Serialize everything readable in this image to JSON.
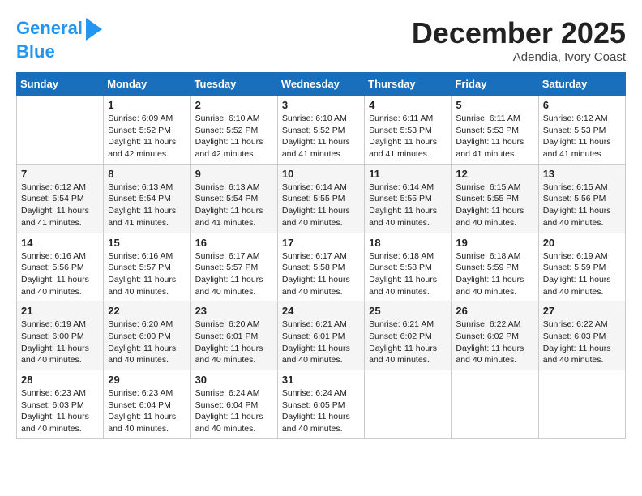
{
  "header": {
    "logo_line1": "General",
    "logo_line2": "Blue",
    "month": "December 2025",
    "location": "Adendia, Ivory Coast"
  },
  "days_of_week": [
    "Sunday",
    "Monday",
    "Tuesday",
    "Wednesday",
    "Thursday",
    "Friday",
    "Saturday"
  ],
  "weeks": [
    [
      {
        "day": "",
        "sunrise": "",
        "sunset": "",
        "daylight": ""
      },
      {
        "day": "1",
        "sunrise": "Sunrise: 6:09 AM",
        "sunset": "Sunset: 5:52 PM",
        "daylight": "Daylight: 11 hours and 42 minutes."
      },
      {
        "day": "2",
        "sunrise": "Sunrise: 6:10 AM",
        "sunset": "Sunset: 5:52 PM",
        "daylight": "Daylight: 11 hours and 42 minutes."
      },
      {
        "day": "3",
        "sunrise": "Sunrise: 6:10 AM",
        "sunset": "Sunset: 5:52 PM",
        "daylight": "Daylight: 11 hours and 41 minutes."
      },
      {
        "day": "4",
        "sunrise": "Sunrise: 6:11 AM",
        "sunset": "Sunset: 5:53 PM",
        "daylight": "Daylight: 11 hours and 41 minutes."
      },
      {
        "day": "5",
        "sunrise": "Sunrise: 6:11 AM",
        "sunset": "Sunset: 5:53 PM",
        "daylight": "Daylight: 11 hours and 41 minutes."
      },
      {
        "day": "6",
        "sunrise": "Sunrise: 6:12 AM",
        "sunset": "Sunset: 5:53 PM",
        "daylight": "Daylight: 11 hours and 41 minutes."
      }
    ],
    [
      {
        "day": "7",
        "sunrise": "Sunrise: 6:12 AM",
        "sunset": "Sunset: 5:54 PM",
        "daylight": "Daylight: 11 hours and 41 minutes."
      },
      {
        "day": "8",
        "sunrise": "Sunrise: 6:13 AM",
        "sunset": "Sunset: 5:54 PM",
        "daylight": "Daylight: 11 hours and 41 minutes."
      },
      {
        "day": "9",
        "sunrise": "Sunrise: 6:13 AM",
        "sunset": "Sunset: 5:54 PM",
        "daylight": "Daylight: 11 hours and 41 minutes."
      },
      {
        "day": "10",
        "sunrise": "Sunrise: 6:14 AM",
        "sunset": "Sunset: 5:55 PM",
        "daylight": "Daylight: 11 hours and 40 minutes."
      },
      {
        "day": "11",
        "sunrise": "Sunrise: 6:14 AM",
        "sunset": "Sunset: 5:55 PM",
        "daylight": "Daylight: 11 hours and 40 minutes."
      },
      {
        "day": "12",
        "sunrise": "Sunrise: 6:15 AM",
        "sunset": "Sunset: 5:55 PM",
        "daylight": "Daylight: 11 hours and 40 minutes."
      },
      {
        "day": "13",
        "sunrise": "Sunrise: 6:15 AM",
        "sunset": "Sunset: 5:56 PM",
        "daylight": "Daylight: 11 hours and 40 minutes."
      }
    ],
    [
      {
        "day": "14",
        "sunrise": "Sunrise: 6:16 AM",
        "sunset": "Sunset: 5:56 PM",
        "daylight": "Daylight: 11 hours and 40 minutes."
      },
      {
        "day": "15",
        "sunrise": "Sunrise: 6:16 AM",
        "sunset": "Sunset: 5:57 PM",
        "daylight": "Daylight: 11 hours and 40 minutes."
      },
      {
        "day": "16",
        "sunrise": "Sunrise: 6:17 AM",
        "sunset": "Sunset: 5:57 PM",
        "daylight": "Daylight: 11 hours and 40 minutes."
      },
      {
        "day": "17",
        "sunrise": "Sunrise: 6:17 AM",
        "sunset": "Sunset: 5:58 PM",
        "daylight": "Daylight: 11 hours and 40 minutes."
      },
      {
        "day": "18",
        "sunrise": "Sunrise: 6:18 AM",
        "sunset": "Sunset: 5:58 PM",
        "daylight": "Daylight: 11 hours and 40 minutes."
      },
      {
        "day": "19",
        "sunrise": "Sunrise: 6:18 AM",
        "sunset": "Sunset: 5:59 PM",
        "daylight": "Daylight: 11 hours and 40 minutes."
      },
      {
        "day": "20",
        "sunrise": "Sunrise: 6:19 AM",
        "sunset": "Sunset: 5:59 PM",
        "daylight": "Daylight: 11 hours and 40 minutes."
      }
    ],
    [
      {
        "day": "21",
        "sunrise": "Sunrise: 6:19 AM",
        "sunset": "Sunset: 6:00 PM",
        "daylight": "Daylight: 11 hours and 40 minutes."
      },
      {
        "day": "22",
        "sunrise": "Sunrise: 6:20 AM",
        "sunset": "Sunset: 6:00 PM",
        "daylight": "Daylight: 11 hours and 40 minutes."
      },
      {
        "day": "23",
        "sunrise": "Sunrise: 6:20 AM",
        "sunset": "Sunset: 6:01 PM",
        "daylight": "Daylight: 11 hours and 40 minutes."
      },
      {
        "day": "24",
        "sunrise": "Sunrise: 6:21 AM",
        "sunset": "Sunset: 6:01 PM",
        "daylight": "Daylight: 11 hours and 40 minutes."
      },
      {
        "day": "25",
        "sunrise": "Sunrise: 6:21 AM",
        "sunset": "Sunset: 6:02 PM",
        "daylight": "Daylight: 11 hours and 40 minutes."
      },
      {
        "day": "26",
        "sunrise": "Sunrise: 6:22 AM",
        "sunset": "Sunset: 6:02 PM",
        "daylight": "Daylight: 11 hours and 40 minutes."
      },
      {
        "day": "27",
        "sunrise": "Sunrise: 6:22 AM",
        "sunset": "Sunset: 6:03 PM",
        "daylight": "Daylight: 11 hours and 40 minutes."
      }
    ],
    [
      {
        "day": "28",
        "sunrise": "Sunrise: 6:23 AM",
        "sunset": "Sunset: 6:03 PM",
        "daylight": "Daylight: 11 hours and 40 minutes."
      },
      {
        "day": "29",
        "sunrise": "Sunrise: 6:23 AM",
        "sunset": "Sunset: 6:04 PM",
        "daylight": "Daylight: 11 hours and 40 minutes."
      },
      {
        "day": "30",
        "sunrise": "Sunrise: 6:24 AM",
        "sunset": "Sunset: 6:04 PM",
        "daylight": "Daylight: 11 hours and 40 minutes."
      },
      {
        "day": "31",
        "sunrise": "Sunrise: 6:24 AM",
        "sunset": "Sunset: 6:05 PM",
        "daylight": "Daylight: 11 hours and 40 minutes."
      },
      {
        "day": "",
        "sunrise": "",
        "sunset": "",
        "daylight": ""
      },
      {
        "day": "",
        "sunrise": "",
        "sunset": "",
        "daylight": ""
      },
      {
        "day": "",
        "sunrise": "",
        "sunset": "",
        "daylight": ""
      }
    ]
  ]
}
